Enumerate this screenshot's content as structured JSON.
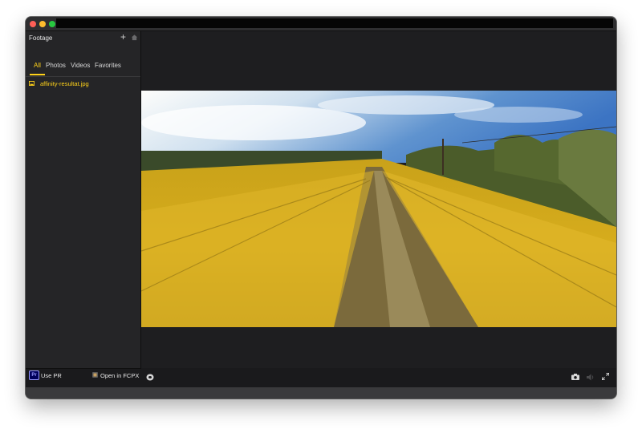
{
  "window": {
    "title": ""
  },
  "sidebar": {
    "title": "Footage",
    "add_icon": "plus-icon",
    "home_icon": "home-icon",
    "tabs": [
      {
        "label": "All",
        "active": true
      },
      {
        "label": "Photos",
        "active": false
      },
      {
        "label": "Videos",
        "active": false
      },
      {
        "label": "Favorites",
        "active": false
      }
    ],
    "files": [
      {
        "name": "affinity-resultat.jpg",
        "icon": "image-file-icon"
      }
    ],
    "view_icons": [
      "grid-view-icon",
      "list-view-icon"
    ],
    "delete_icon": "trash-icon"
  },
  "bottom": {
    "pr_badge": "Pr",
    "use_pr_label": "Use PR",
    "open_fcpx_label": "Open in FCPX"
  },
  "player": {
    "icons": [
      "rotate-360-icon",
      "camera-icon",
      "speaker-icon",
      "fullscreen-icon"
    ]
  },
  "colors": {
    "accent": "#ffd21a",
    "window_bg": "#1c1c1e",
    "sidebar_bg": "#252527"
  }
}
